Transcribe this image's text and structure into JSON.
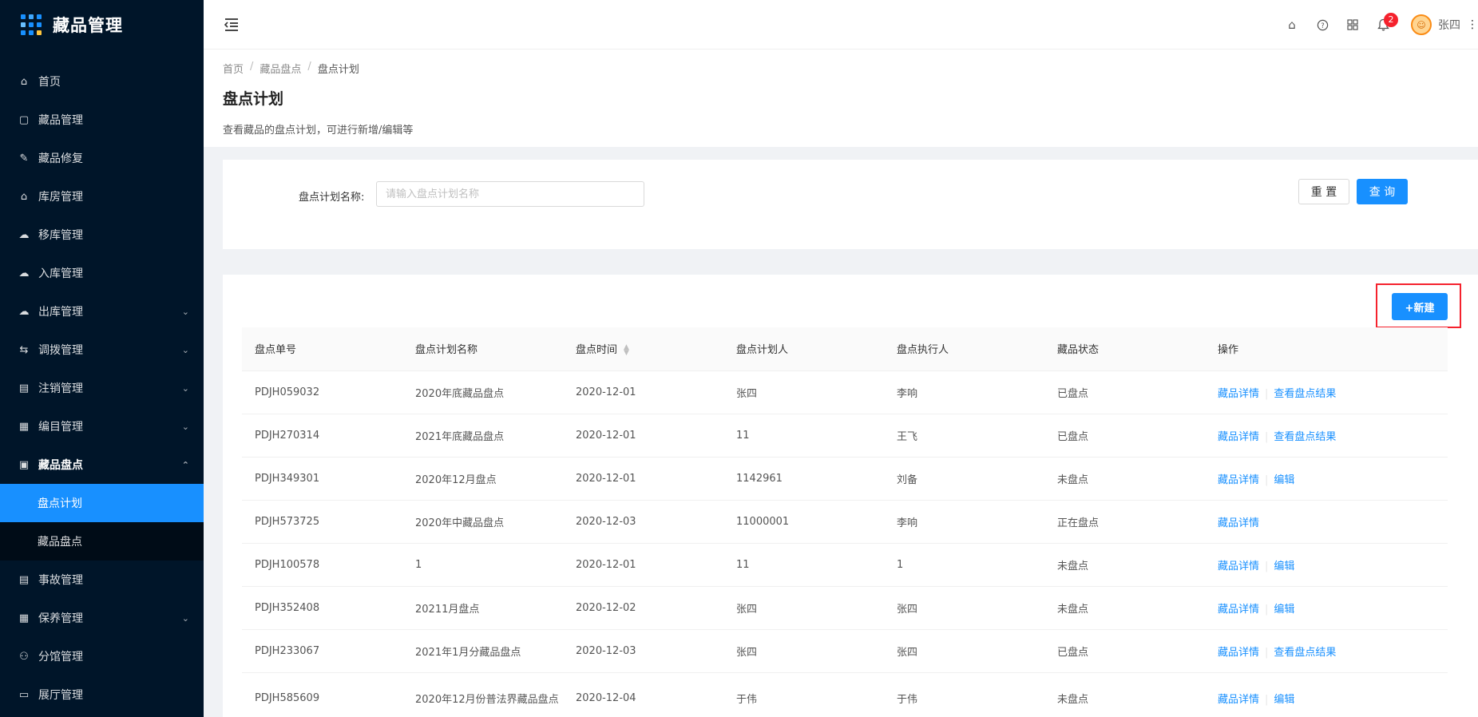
{
  "app": {
    "title": "藏品管理"
  },
  "sidebar": {
    "items": [
      {
        "label": "首页",
        "icon": "home-icon"
      },
      {
        "label": "藏品管理",
        "icon": "calendar-icon"
      },
      {
        "label": "藏品修复",
        "icon": "wrench-icon"
      },
      {
        "label": "库房管理",
        "icon": "warehouse-icon"
      },
      {
        "label": "移库管理",
        "icon": "cloud-icon"
      },
      {
        "label": "入库管理",
        "icon": "cloud-upload-icon"
      },
      {
        "label": "出库管理",
        "icon": "cloud-download-icon"
      },
      {
        "label": "调拨管理",
        "icon": "transfer-icon"
      },
      {
        "label": "注销管理",
        "icon": "file-icon"
      },
      {
        "label": "编目管理",
        "icon": "catalog-icon"
      },
      {
        "label": "藏品盘点",
        "icon": "inventory-icon"
      }
    ],
    "subitems": [
      {
        "label": "盘点计划"
      },
      {
        "label": "藏品盘点"
      }
    ],
    "items_after": [
      {
        "label": "事故管理",
        "icon": "accident-icon"
      },
      {
        "label": "保养管理",
        "icon": "maintenance-icon"
      },
      {
        "label": "分馆管理",
        "icon": "branch-icon"
      },
      {
        "label": "展厅管理",
        "icon": "hall-icon"
      }
    ]
  },
  "header": {
    "notification_count": "2",
    "username": "张四"
  },
  "breadcrumb": [
    "首页",
    "藏品盘点",
    "盘点计划"
  ],
  "page": {
    "title": "盘点计划",
    "description": "查看藏品的盘点计划，可进行新增/编辑等"
  },
  "search": {
    "label": "盘点计划名称:",
    "placeholder": "请输入盘点计划名称",
    "reset_label": "重 置",
    "query_label": "查 询"
  },
  "table": {
    "new_label": "+新建",
    "columns": [
      "盘点单号",
      "盘点计划名称",
      "盘点时间",
      "盘点计划人",
      "盘点执行人",
      "藏品状态",
      "操作"
    ],
    "rows": [
      [
        "PDJH059032",
        "2020年底藏品盘点",
        "2020-12-01",
        "张四",
        "李响",
        "已盘点",
        "藏品详情",
        "查看盘点结果"
      ],
      [
        "PDJH270314",
        "2021年底藏品盘点",
        "2020-12-01",
        "11",
        "王飞",
        "已盘点",
        "藏品详情",
        "查看盘点结果"
      ],
      [
        "PDJH349301",
        "2020年12月盘点",
        "2020-12-01",
        "1142961",
        "刘备",
        "未盘点",
        "藏品详情",
        "编辑"
      ],
      [
        "PDJH573725",
        "2020年中藏品盘点",
        "2020-12-03",
        "11000001",
        "李响",
        "正在盘点",
        "藏品详情",
        ""
      ],
      [
        "PDJH100578",
        "1",
        "2020-12-01",
        "11",
        "1",
        "未盘点",
        "藏品详情",
        "编辑"
      ],
      [
        "PDJH352408",
        "20211月盘点",
        "2020-12-02",
        "张四",
        "张四",
        "未盘点",
        "藏品详情",
        "编辑"
      ],
      [
        "PDJH233067",
        "2021年1月分藏品盘点",
        "2020-12-03",
        "张四",
        "张四",
        "已盘点",
        "藏品详情",
        "查看盘点结果"
      ],
      [
        "PDJH585609",
        "2020年12月份普法界藏品盘点",
        "2020-12-04",
        "于伟",
        "于伟",
        "未盘点",
        "藏品详情",
        "编辑"
      ]
    ]
  }
}
